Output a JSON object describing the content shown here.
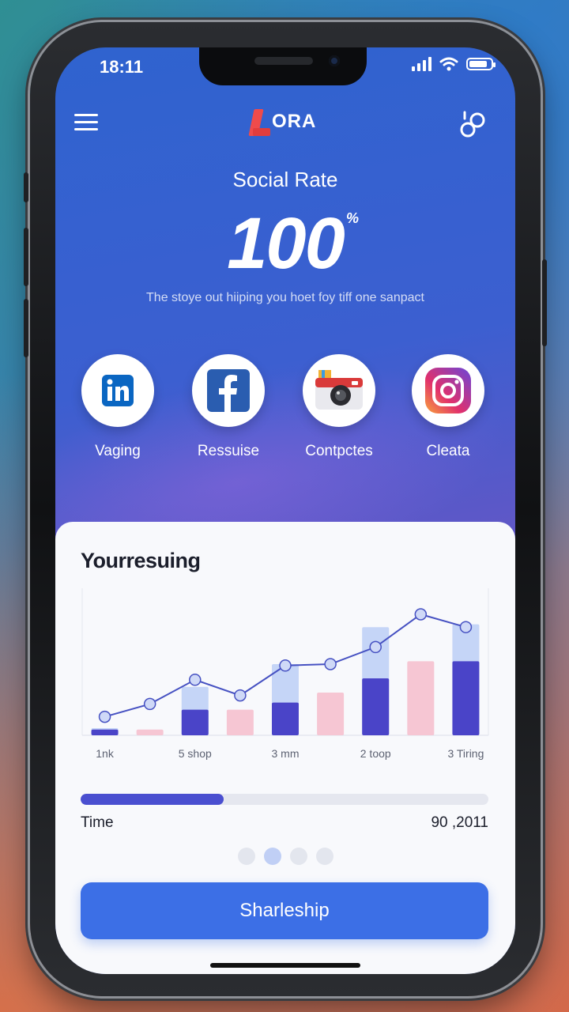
{
  "status_bar": {
    "time": "18:11"
  },
  "header": {
    "logo_text": "ORA"
  },
  "hero": {
    "title": "Social Rate",
    "value": "100",
    "unit": "%",
    "subtitle": "The stoye out hiiping you hoet foy tiff one sanpact"
  },
  "socials": [
    {
      "icon": "linkedin-icon",
      "label": "Vaging",
      "color": "#0a66c2"
    },
    {
      "icon": "facebook-icon",
      "label": "Ressuise",
      "color": "#1877f2"
    },
    {
      "icon": "camera-icon",
      "label": "Contpctes",
      "color": "#d93a3a"
    },
    {
      "icon": "instagram-icon",
      "label": "Cleata",
      "color": "#e1306c"
    }
  ],
  "card": {
    "title": "Yourresuing",
    "progress": {
      "label": "Time",
      "value_text": "90 ,2011",
      "fraction": 0.35
    },
    "carousel": {
      "count": 4,
      "active_index": 1
    },
    "cta_label": "Sharleship"
  },
  "chart_data": {
    "type": "bar",
    "categories": [
      "1nk",
      "",
      "5 shop",
      "",
      "3 mm",
      "",
      "2 toop",
      "",
      "3 Tiring"
    ],
    "series": [
      {
        "kind": "bar-light",
        "values": [
          5,
          0,
          34,
          0,
          50,
          0,
          76,
          0,
          78
        ],
        "color": "#c5d5f7"
      },
      {
        "kind": "bar-dark",
        "values": [
          4,
          0,
          18,
          0,
          23,
          0,
          40,
          0,
          52
        ],
        "color": "#4a44c8"
      },
      {
        "kind": "bar-pink",
        "values": [
          0,
          4,
          0,
          18,
          0,
          30,
          0,
          52,
          0
        ],
        "color": "#f6c6d3"
      },
      {
        "kind": "line",
        "values": [
          13,
          22,
          39,
          28,
          49,
          50,
          62,
          85,
          76
        ],
        "color": "#4651c2"
      }
    ],
    "ylim": [
      0,
      100
    ],
    "grid": false,
    "xlabel": "",
    "ylabel": ""
  },
  "colors": {
    "accent": "#3c6fe6",
    "progress": "#4a4fd0"
  }
}
